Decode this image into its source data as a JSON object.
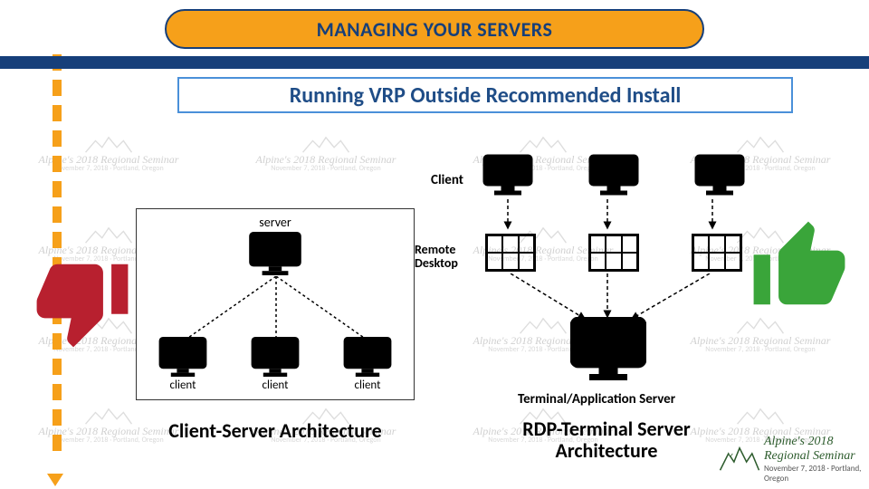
{
  "title": "MANAGING YOUR SERVERS",
  "subtitle": "Running VRP Outside Recommended Install",
  "left_diagram": {
    "server_label": "server",
    "client_label": "client",
    "caption": "Client-Server Architecture"
  },
  "right_diagram": {
    "client_label": "Client",
    "remote_label_l1": "Remote",
    "remote_label_l2": "Desktop",
    "server_label": "Terminal/Application Server",
    "caption": "RDP-Terminal Server Architecture"
  },
  "watermark": {
    "line1": "Alpine's 2018 Regional Seminar",
    "line2": "November 7, 2018 · Portland, Oregon"
  },
  "event": {
    "line1": "Alpine's 2018 Regional Seminar",
    "line2": "November 7, 2018 · Portland, Oregon"
  },
  "icons": {
    "thumb_down": "thumb-down-icon",
    "thumb_up": "thumb-up-icon",
    "monitor": "monitor-icon",
    "mountain": "mountain-icon"
  },
  "colors": {
    "banner_fill": "#f6a01a",
    "banner_border": "#163f7a",
    "stripe": "#163f7a",
    "sub_border": "#4a90d9",
    "thumb_down": "#b8202f",
    "thumb_up": "#3aa53a"
  }
}
